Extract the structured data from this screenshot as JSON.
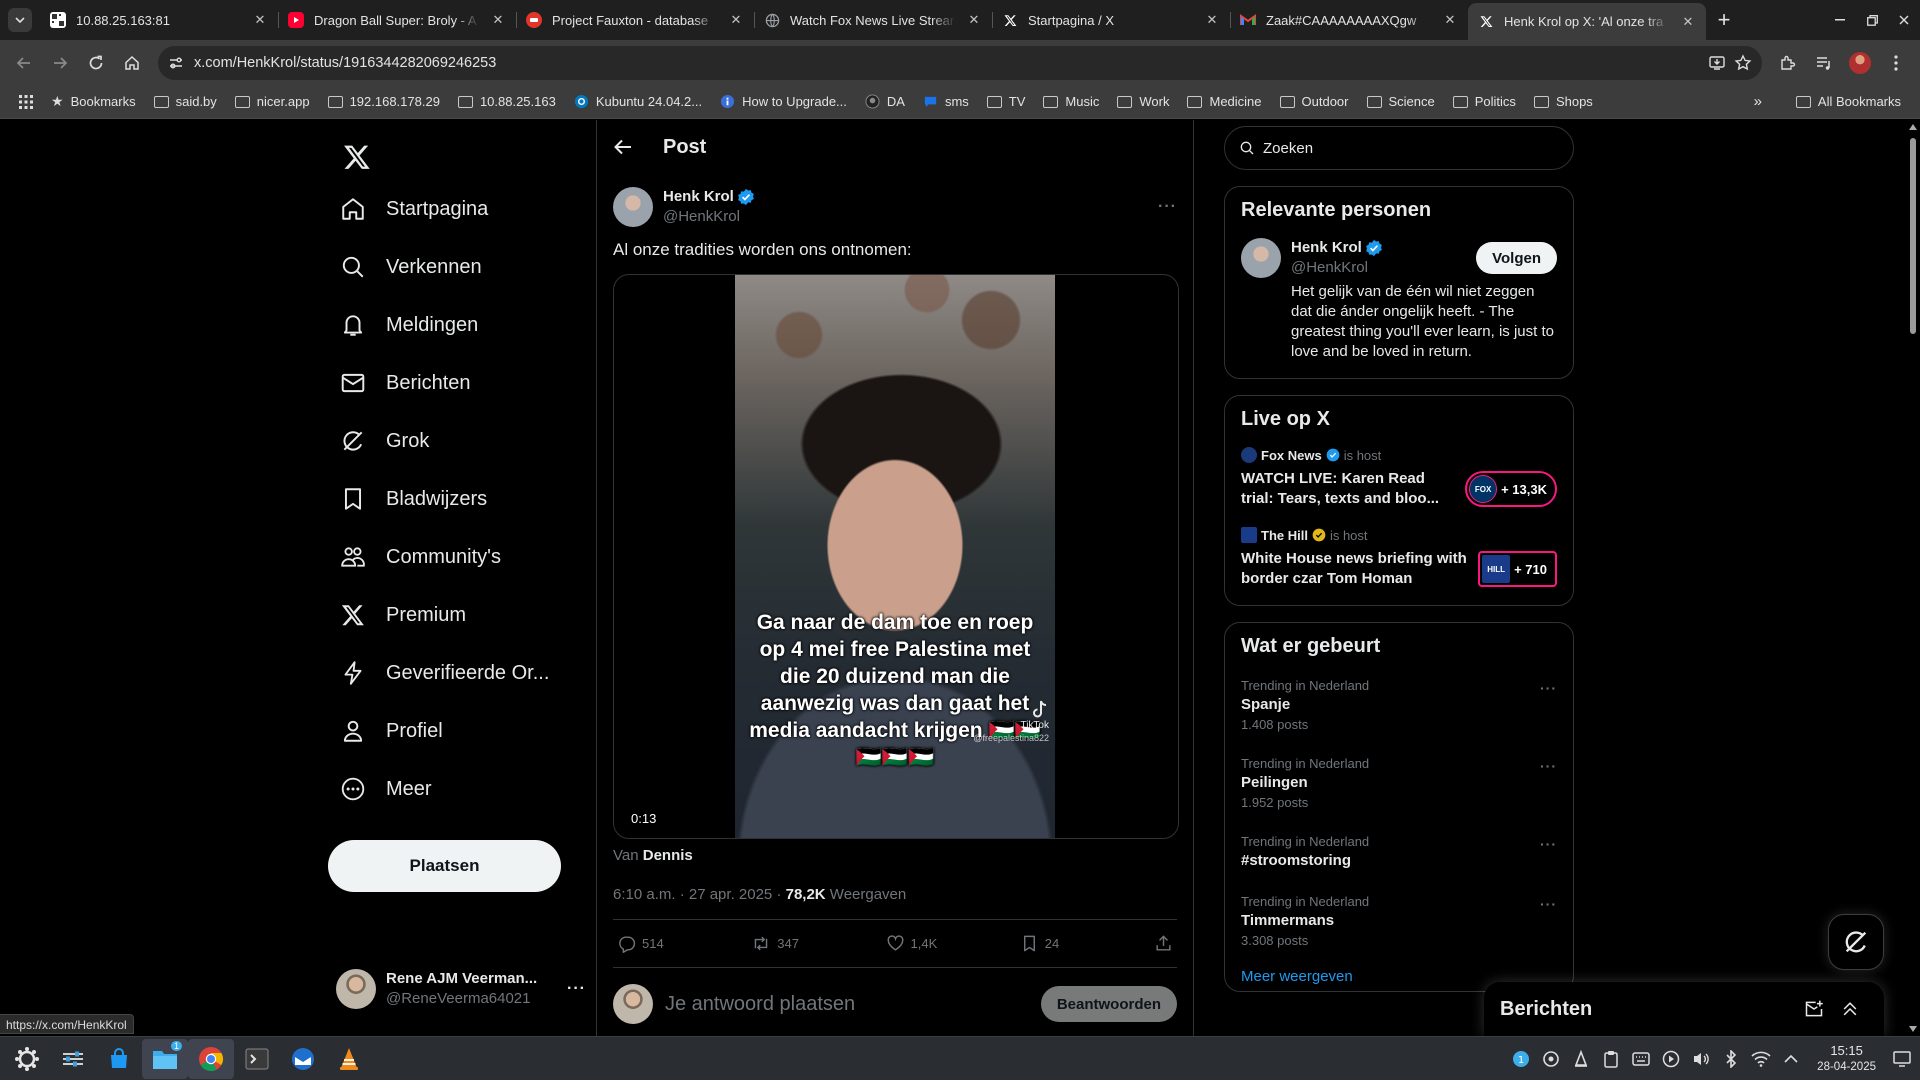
{
  "browser": {
    "tabs": [
      {
        "title": "10.88.25.163:81",
        "favicon_color": "#ffffff",
        "active": false
      },
      {
        "title": "Dragon Ball Super: Broly - A",
        "favicon_color": "#ff0033",
        "active": false
      },
      {
        "title": "Project Fauxton - database",
        "favicon_color": "#e0352b",
        "active": false
      },
      {
        "title": "Watch Fox News Live Strear",
        "favicon_color": "#9aa0a6",
        "active": false
      },
      {
        "title": "Startpagina / X",
        "favicon_color": "#ffffff",
        "active": false
      },
      {
        "title": "Zaak#CAAAAAAAAXQgw",
        "favicon_color": "#ea4335",
        "active": false
      },
      {
        "title": "Henk Krol op X: 'Al onze tra",
        "favicon_color": "#ffffff",
        "active": true
      }
    ],
    "url": "x.com/HenkKrol/status/1916344282069246253",
    "bookmarks": [
      {
        "label": "Bookmarks",
        "icon": "star-icon"
      },
      {
        "label": "said.by",
        "icon": "folder-icon"
      },
      {
        "label": "nicer.app",
        "icon": "folder-icon"
      },
      {
        "label": "192.168.178.29",
        "icon": "folder-icon"
      },
      {
        "label": "10.88.25.163",
        "icon": "folder-icon"
      },
      {
        "label": "Kubuntu 24.04.2...",
        "icon": "kubuntu-icon"
      },
      {
        "label": "How to Upgrade...",
        "icon": "info-icon"
      },
      {
        "label": "DA",
        "icon": "github-icon"
      },
      {
        "label": "sms",
        "icon": "chat-icon"
      },
      {
        "label": "TV",
        "icon": "folder-icon"
      },
      {
        "label": "Music",
        "icon": "folder-icon"
      },
      {
        "label": "Work",
        "icon": "folder-icon"
      },
      {
        "label": "Medicine",
        "icon": "folder-icon"
      },
      {
        "label": "Outdoor",
        "icon": "folder-icon"
      },
      {
        "label": "Science",
        "icon": "folder-icon"
      },
      {
        "label": "Politics",
        "icon": "folder-icon"
      },
      {
        "label": "Shops",
        "icon": "folder-icon"
      }
    ],
    "all_bookmarks": "All Bookmarks",
    "status_link": "https://x.com/HenkKrol"
  },
  "nav": {
    "items": [
      {
        "label": "Startpagina",
        "icon": "home-icon"
      },
      {
        "label": "Verkennen",
        "icon": "search-icon"
      },
      {
        "label": "Meldingen",
        "icon": "bell-icon"
      },
      {
        "label": "Berichten",
        "icon": "mail-icon"
      },
      {
        "label": "Grok",
        "icon": "grok-icon"
      },
      {
        "label": "Bladwijzers",
        "icon": "bookmark-icon"
      },
      {
        "label": "Community's",
        "icon": "community-icon"
      },
      {
        "label": "Premium",
        "icon": "x-icon"
      },
      {
        "label": "Geverifieerde Or...",
        "icon": "lightning-icon"
      },
      {
        "label": "Profiel",
        "icon": "person-icon"
      },
      {
        "label": "Meer",
        "icon": "more-circle-icon"
      }
    ],
    "post_button": "Plaatsen",
    "account": {
      "name": "Rene AJM Veerman...",
      "handle": "@ReneVeerma64021"
    }
  },
  "main": {
    "header": "Post",
    "tweet": {
      "author_name": "Henk Krol",
      "author_handle": "@HenkKrol",
      "text": "Al onze tradities worden ons ontnomen:",
      "video_caption": "Ga naar de dam toe en roep op 4 mei free Palestina met die 20 duizend man die aanwezig was dan gaat het media aandacht krijgen 🇵🇸🇵🇸🇵🇸🇵🇸🇵🇸",
      "watermark": "TikTok",
      "watermark_handle": "@freepalestina822",
      "duration": "0:13",
      "from_prefix": "Van",
      "from_user": "Dennis",
      "timestamp": "6:10 a.m. · 27 apr. 2025 · ",
      "views_count": "78,2K",
      "views_label": " Weergaven",
      "replies": "514",
      "reposts": "347",
      "likes": "1,4K",
      "bookmarks": "24"
    },
    "reply_placeholder": "Je antwoord plaatsen",
    "reply_button": "Beantwoorden"
  },
  "right": {
    "search_placeholder": "Zoeken",
    "relevant": {
      "title": "Relevante personen",
      "name": "Henk Krol",
      "handle": "@HenkKrol",
      "follow": "Volgen",
      "bio": "Het gelijk van de één wil niet zeggen dat die ánder ongelijk heeft. - The greatest thing you'll ever learn, is just to love and be loved in return."
    },
    "live": {
      "title": "Live op X",
      "items": [
        {
          "host": "Fox News",
          "is_host": "is host",
          "title": "WATCH LIVE: Karen Read trial: Tears, texts and bloo...",
          "count": "+ 13,3K",
          "badge_text": "FOX NEWS",
          "badge_color": "#003366"
        },
        {
          "host": "The Hill",
          "is_host": "is host",
          "title": "White House news briefing with border czar Tom Homan",
          "count": "+ 710",
          "badge_text": "THE HILL",
          "badge_color": "#1a3a8a"
        }
      ]
    },
    "trends": {
      "title": "Wat er gebeurt",
      "items": [
        {
          "category": "Trending in Nederland",
          "name": "Spanje",
          "count": "1.408 posts"
        },
        {
          "category": "Trending in Nederland",
          "name": "Peilingen",
          "count": "1.952 posts"
        },
        {
          "category": "Trending in Nederland",
          "name": "#stroomstoring",
          "count": ""
        },
        {
          "category": "Trending in Nederland",
          "name": "Timmermans",
          "count": "3.308 posts"
        }
      ],
      "show_more": "Meer weergeven"
    }
  },
  "messages_drawer": {
    "title": "Berichten"
  },
  "taskbar": {
    "time": "15:15",
    "date": "28-04-2025",
    "badge": "1"
  },
  "colors": {
    "accent": "#1d9bf0",
    "live": "#f91880",
    "verified_gold": "#e2b719"
  }
}
